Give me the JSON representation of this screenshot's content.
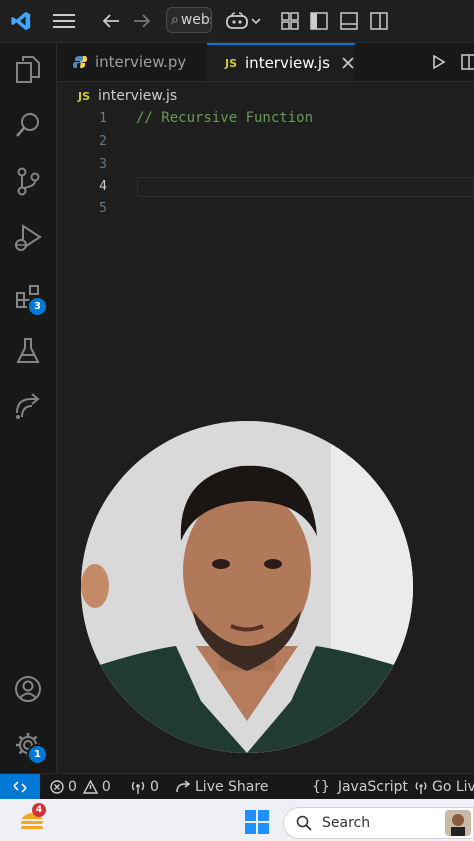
{
  "titlebar": {
    "command_center_text": "webs",
    "nav_back_icon": "arrow-left",
    "nav_forward_icon": "arrow-right"
  },
  "tabs": [
    {
      "label": "interview.py",
      "active": false,
      "icon": "python-icon"
    },
    {
      "label": "interview.js",
      "active": true,
      "icon_text": "JS"
    }
  ],
  "breadcrumb": {
    "icon_text": "JS",
    "file": "interview.js"
  },
  "editor": {
    "line_numbers": [
      "1",
      "2",
      "3",
      "4",
      "5"
    ],
    "current_line": "4",
    "lines": [
      "// Recursive Function",
      "",
      "",
      "",
      ""
    ]
  },
  "activity_bar": {
    "extensions_badge": "3",
    "settings_badge": "1"
  },
  "status_bar": {
    "errors": "0",
    "warnings": "0",
    "ports": "0",
    "live_share": "Live Share",
    "braces": "{}",
    "language": "JavaScript",
    "go_live": "Go Liv"
  },
  "taskbar": {
    "weather_badge": "4",
    "search_placeholder": "Search"
  },
  "colors": {
    "accent": "#0078d4",
    "comment": "#6a9955",
    "js_badge": "#cbcb41"
  }
}
